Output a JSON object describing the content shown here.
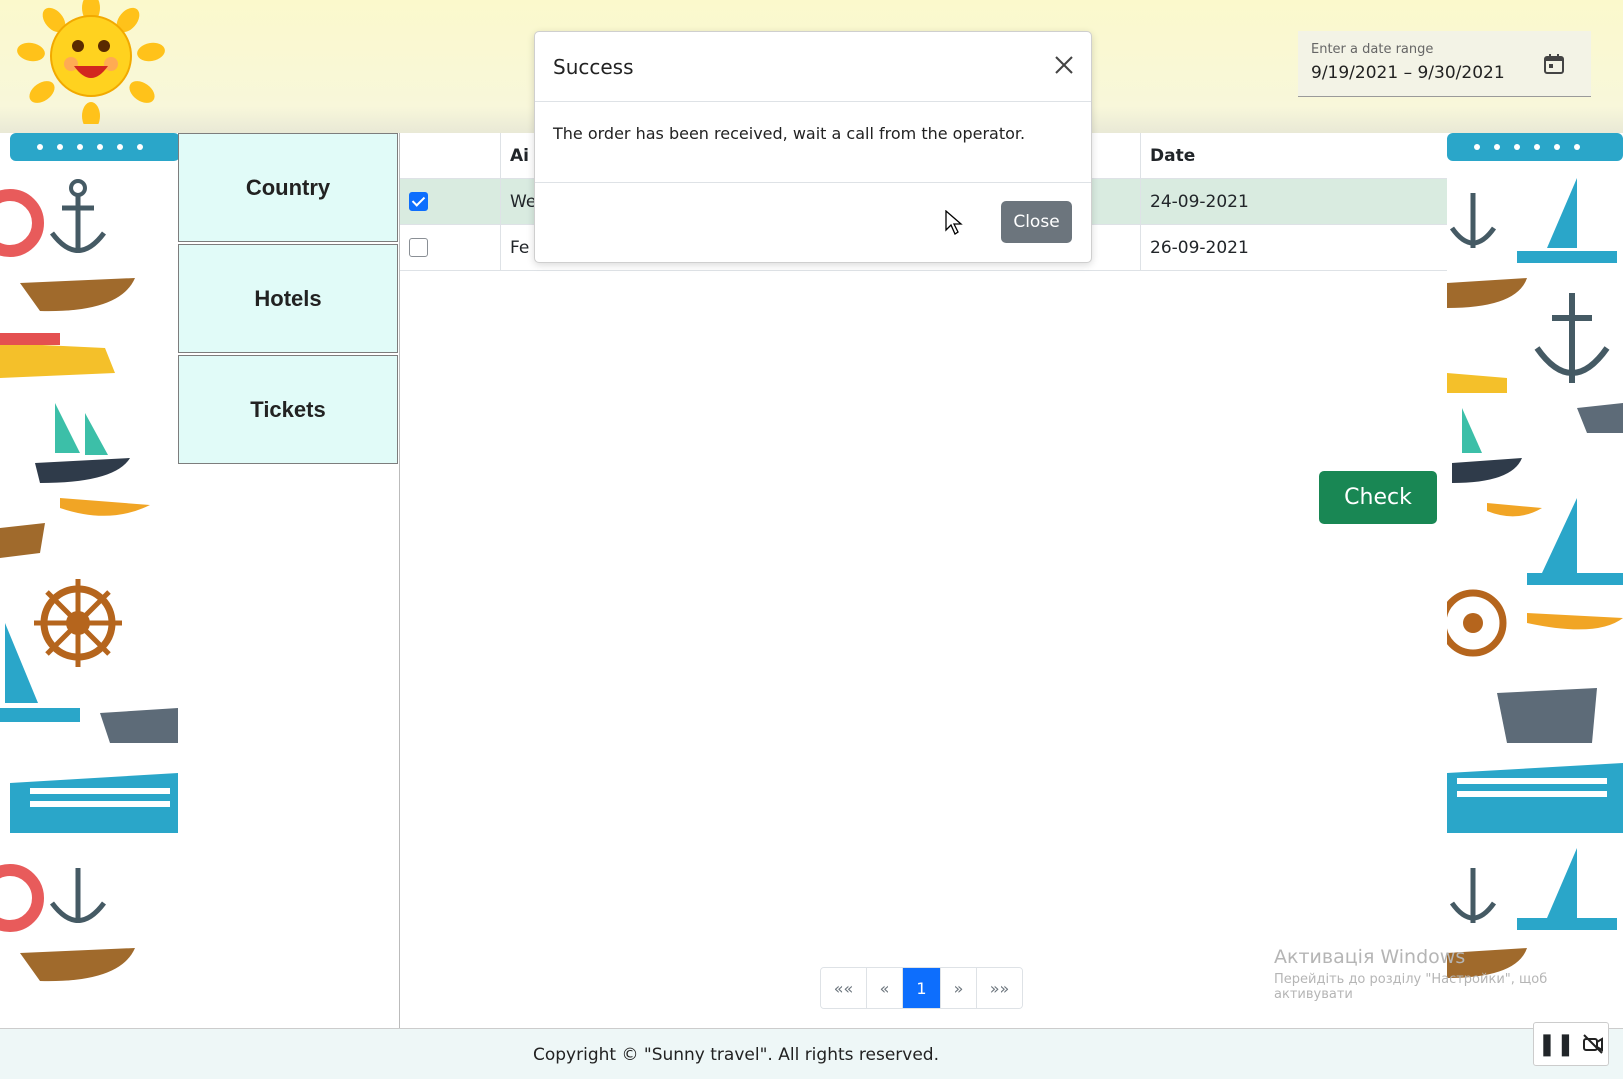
{
  "header": {
    "date_range": {
      "label": "Enter a date range",
      "value": "9/19/2021 – 9/30/2021"
    }
  },
  "sidebar": {
    "items": [
      {
        "label": "Country"
      },
      {
        "label": "Hotels"
      },
      {
        "label": "Tickets"
      }
    ]
  },
  "table": {
    "columns": [
      "",
      "Ai",
      "Date"
    ],
    "rows": [
      {
        "checked": true,
        "name_fragment": "We",
        "date": "24-09-2021"
      },
      {
        "checked": false,
        "name_fragment": "Fe",
        "date": "26-09-2021"
      }
    ]
  },
  "actions": {
    "check_label": "Check"
  },
  "pagination": {
    "first": "««",
    "prev": "«",
    "current": "1",
    "next": "»",
    "last": "»»"
  },
  "modal": {
    "title": "Success",
    "message": "The order has been received, wait a call from the operator.",
    "close_label": "Close"
  },
  "footer": {
    "copyright": "Copyright © \"Sunny travel\". All rights reserved."
  },
  "watermark": {
    "line1": "Активація Windows",
    "line2": "Перейдіть до розділу \"Настройки\", щоб активувати"
  },
  "colors": {
    "accent_green": "#198754",
    "accent_blue": "#0d6efd",
    "sidebar_bg": "#e1fbf8"
  }
}
